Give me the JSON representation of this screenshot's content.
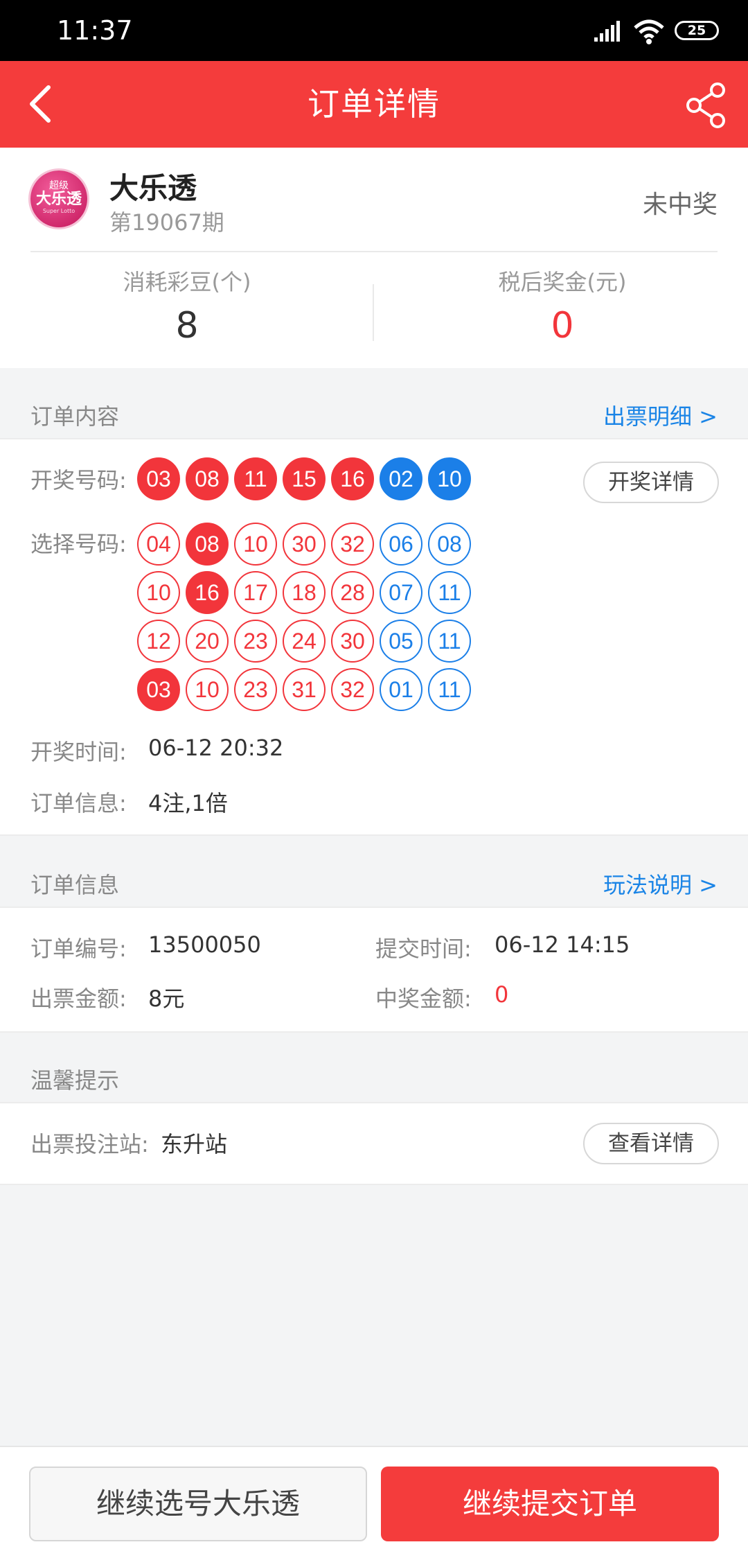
{
  "status_bar": {
    "time": "11:37",
    "battery": "25"
  },
  "header": {
    "title": "订单详情"
  },
  "lottery": {
    "logo_top": "超级",
    "logo_main": "大乐透",
    "logo_sub": "Super Lotto",
    "name": "大乐透",
    "issue": "第19067期",
    "result_status": "未中奖"
  },
  "stats": {
    "beans_label": "消耗彩豆(个)",
    "beans_value": "8",
    "prize_label": "税后奖金(元)",
    "prize_value": "0"
  },
  "order_content": {
    "title": "订单内容",
    "link": "出票明细 >",
    "draw_label": "开奖号码:",
    "draw_numbers": {
      "red": [
        "03",
        "08",
        "11",
        "15",
        "16"
      ],
      "blue": [
        "02",
        "10"
      ]
    },
    "draw_detail_button": "开奖详情",
    "pick_label": "选择号码:",
    "picks": [
      {
        "red": [
          "04",
          "08",
          "10",
          "30",
          "32"
        ],
        "blue": [
          "06",
          "08"
        ],
        "hit_red": [
          "08"
        ]
      },
      {
        "red": [
          "10",
          "16",
          "17",
          "18",
          "28"
        ],
        "blue": [
          "07",
          "11"
        ],
        "hit_red": [
          "16"
        ]
      },
      {
        "red": [
          "12",
          "20",
          "23",
          "24",
          "30"
        ],
        "blue": [
          "05",
          "11"
        ],
        "hit_red": []
      },
      {
        "red": [
          "03",
          "10",
          "23",
          "31",
          "32"
        ],
        "blue": [
          "01",
          "11"
        ],
        "hit_red": [
          "03"
        ]
      }
    ],
    "draw_time_label": "开奖时间:",
    "draw_time_value": "06-12 20:32",
    "order_info_label": "订单信息:",
    "order_info_value": "4注,1倍"
  },
  "order_info": {
    "title": "订单信息",
    "link": "玩法说明 >",
    "order_no_label": "订单编号:",
    "order_no_value": "13500050",
    "submit_time_label": "提交时间:",
    "submit_time_value": "06-12 14:15",
    "ticket_amount_label": "出票金额:",
    "ticket_amount_value": "8元",
    "win_amount_label": "中奖金额:",
    "win_amount_value": "0"
  },
  "tips": {
    "title": "温馨提示",
    "station_label": "出票投注站:",
    "station_value": "东升站",
    "detail_button": "查看详情"
  },
  "bottom": {
    "continue_pick": "继续选号大乐透",
    "continue_submit": "继续提交订单"
  },
  "colors": {
    "accent": "#f43c3c",
    "ball_red": "#f2353b",
    "ball_blue": "#1b7fe8",
    "link": "#1a84e6"
  }
}
